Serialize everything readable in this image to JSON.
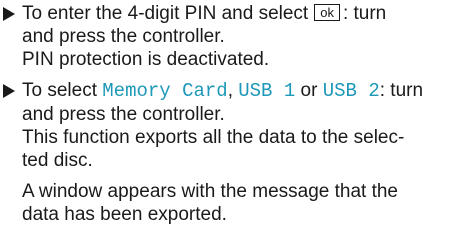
{
  "steps": [
    {
      "line1_before": "To enter the 4-digit PIN and select",
      "ok_label": "ok",
      "line1_after": ": turn",
      "line2": "and press the controller.",
      "result": "PIN protection is deactivated."
    },
    {
      "line1_prefix": "To select ",
      "options": [
        "Memory Card",
        "USB 1",
        "USB 2"
      ],
      "sep1": ",",
      "sep2": " or ",
      "line1_suffix": ": turn",
      "line2": "and press the controller.",
      "result_line1": "This function exports all the data to the selec-",
      "result_line2": "ted disc.",
      "note_line1": "A window appears with the message that the",
      "note_line2": "data has been exported."
    }
  ],
  "colors": {
    "highlight": "#1e98b8",
    "text": "#1a1a1a"
  }
}
